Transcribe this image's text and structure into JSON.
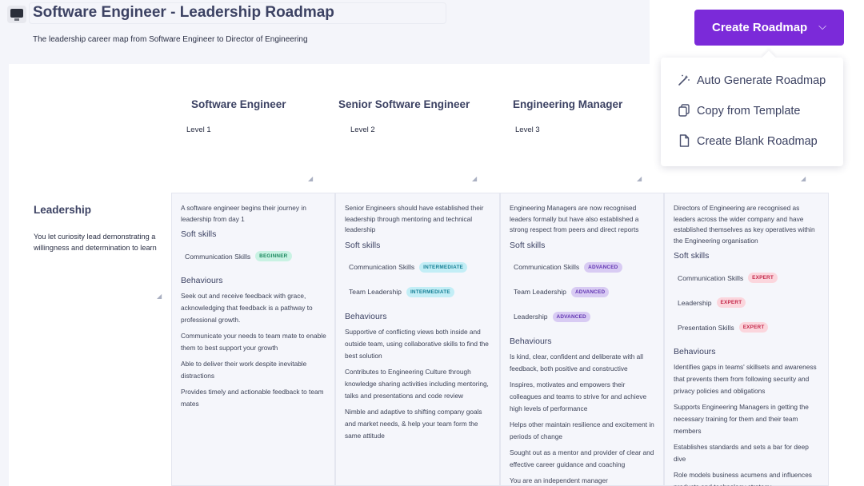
{
  "header": {
    "title": "Software Engineer - Leadership Roadmap",
    "subtitle": "The leadership career map from Software Engineer to Director of Engineering"
  },
  "create_button": {
    "label": "Create Roadmap"
  },
  "menu": {
    "items": [
      {
        "label": "Auto Generate Roadmap",
        "icon": "magic-wand-icon"
      },
      {
        "label": "Copy from Template",
        "icon": "copy-icon"
      },
      {
        "label": "Create Blank Roadmap",
        "icon": "document-icon"
      }
    ]
  },
  "columns": [
    {
      "title": "Software Engineer",
      "level": "Level 1"
    },
    {
      "title": "Senior Software Engineer",
      "level": "Level 2"
    },
    {
      "title": "Engineering Manager",
      "level": "Level 3"
    }
  ],
  "row": {
    "title": "Leadership",
    "description": "You let curiosity lead demonstrating a willingness and determination to learn"
  },
  "labels": {
    "soft_skills": "Soft skills",
    "behaviours": "Behaviours"
  },
  "cells": [
    {
      "intro": "A software engineer begins their journey in leadership from day 1",
      "skills": [
        {
          "name": "Communication Skills",
          "level": "BEGINNER"
        }
      ],
      "behaviours": [
        "Seek out and receive feedback with grace, acknowledging that feedback is a pathway to professional growth.",
        "Communicate your needs to team mate to enable them to best support your growth",
        "Able to deliver their work despite inevitable distractions",
        "Provides timely and actionable feedback to team mates"
      ]
    },
    {
      "intro": "Senior Engineers should have established their leadership through mentoring and technical leadership",
      "skills": [
        {
          "name": "Communication Skills",
          "level": "INTERMEDIATE"
        },
        {
          "name": "Team Leadership",
          "level": "INTERMEDIATE"
        }
      ],
      "behaviours": [
        "Supportive of conflicting views both inside and outside team, using collaborative skills to find the best solution",
        "Contributes to Engineering Culture through knowledge sharing activities including mentoring, talks and presentations and code review",
        "Nimble and adaptive to shifting company goals and market needs, & help your team form the same attitude"
      ]
    },
    {
      "intro": "Engineering Managers are now recognised leaders formally but have also established a strong respect from peers and direct reports",
      "skills": [
        {
          "name": "Communication Skills",
          "level": "ADVANCED"
        },
        {
          "name": "Team Leadership",
          "level": "ADVANCED"
        },
        {
          "name": "Leadership",
          "level": "ADVANCED"
        }
      ],
      "behaviours": [
        "Is kind, clear, confident and deliberate with all feedback, both positive and constructive",
        "Inspires, motivates and empowers their colleagues and teams to strive for and achieve high levels of performance",
        "Helps other maintain resilience and excitement in periods of change",
        "Sought out as a mentor and provider of clear and effective career guidance and coaching",
        "You are an independent manager"
      ]
    },
    {
      "intro": "Directors of Engineering are recognised as leaders across the wider company and have established themselves as key operatives within the Engineering organisation",
      "skills": [
        {
          "name": "Communication Skills",
          "level": "EXPERT"
        },
        {
          "name": "Leadership",
          "level": "EXPERT"
        },
        {
          "name": "Presentation Skills",
          "level": "EXPERT"
        }
      ],
      "behaviours": [
        "Identifies gaps in teams' skillsets and awareness that prevents them from following security and privacy policies and obligations",
        "Supports Engineering Managers in getting the necessary training for them and their team members",
        "Establishes standards and sets a bar for deep dive",
        "Role models business acumens and influences products and technology strategy"
      ]
    }
  ]
}
